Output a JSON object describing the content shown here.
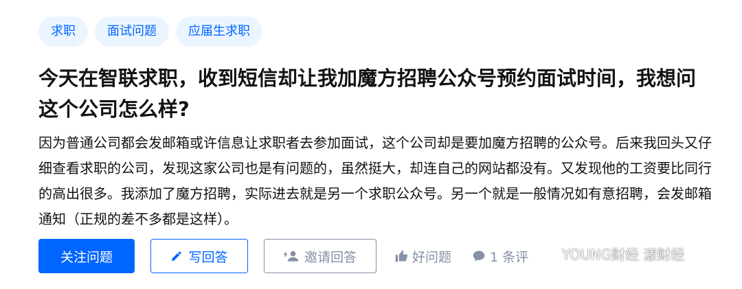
{
  "tags": [
    {
      "label": "求职"
    },
    {
      "label": "面试问题"
    },
    {
      "label": "应届生求职"
    }
  ],
  "question": {
    "title": "今天在智联求职，收到短信却让我加魔方招聘公众号预约面试时间，我想问这个公司怎么样?",
    "detail": "因为普通公司都会发邮箱或许信息让求职者去参加面试，这个公司却是要加魔方招聘的公众号。后来我回头又仔细查看求职的公司，发现这家公司也是有问题的，虽然挺大，却连自己的网站都没有。又发现他的工资要比同行的高出很多。我添加了魔方招聘，实际进去就是另一个求职公众号。另一个就是一般情况如有意招聘，会发邮箱通知（正规的差不多都是这样）。"
  },
  "actions": {
    "follow_label": "关注问题",
    "write_label": "写回答",
    "invite_label": "邀请回答",
    "good_question_label": "好问题",
    "comments_label": "1 条评"
  },
  "watermark": {
    "text": "YOUNG财经 漾财经"
  },
  "colors": {
    "accent": "#0066ff",
    "tag_bg": "#ebf5ff",
    "muted": "#8590a6",
    "text": "#121212"
  },
  "icons": {
    "write": "pencil-icon",
    "invite": "add-user-icon",
    "good_question": "thumbs-up-icon",
    "comments": "comment-bubble-icon",
    "watermark": "wechat-icon"
  }
}
